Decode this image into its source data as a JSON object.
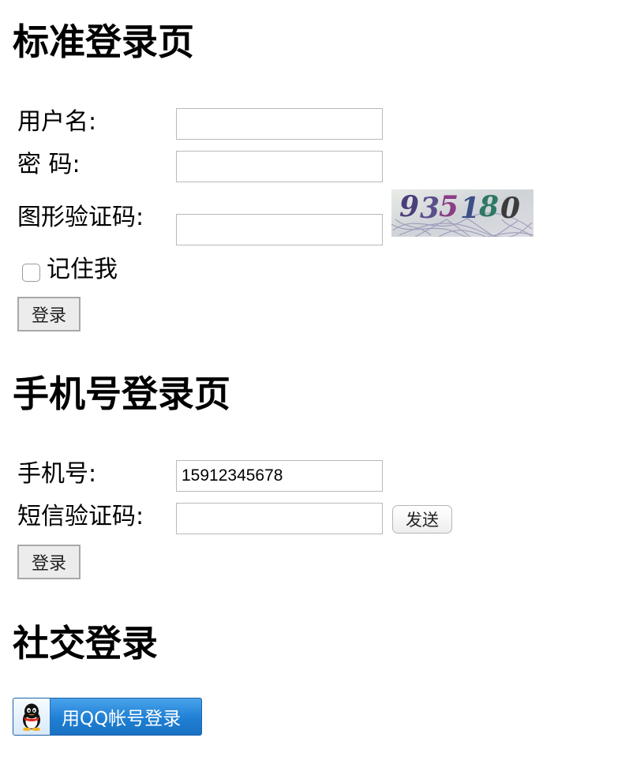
{
  "standard": {
    "heading": "标准登录页",
    "username_label": "用户名:",
    "username_value": "",
    "password_label": "密 码:",
    "password_value": "",
    "captcha_label": "图形验证码:",
    "captcha_value": "",
    "captcha_text": "935180",
    "remember_label": "记住我",
    "login_button": "登录"
  },
  "mobile": {
    "heading": "手机号登录页",
    "phone_label": "手机号:",
    "phone_value": "15912345678",
    "sms_label": "短信验证码:",
    "sms_value": "",
    "send_button": "发送",
    "login_button": "登录"
  },
  "social": {
    "heading": "社交登录",
    "qq_button": "用QQ帐号登录"
  }
}
